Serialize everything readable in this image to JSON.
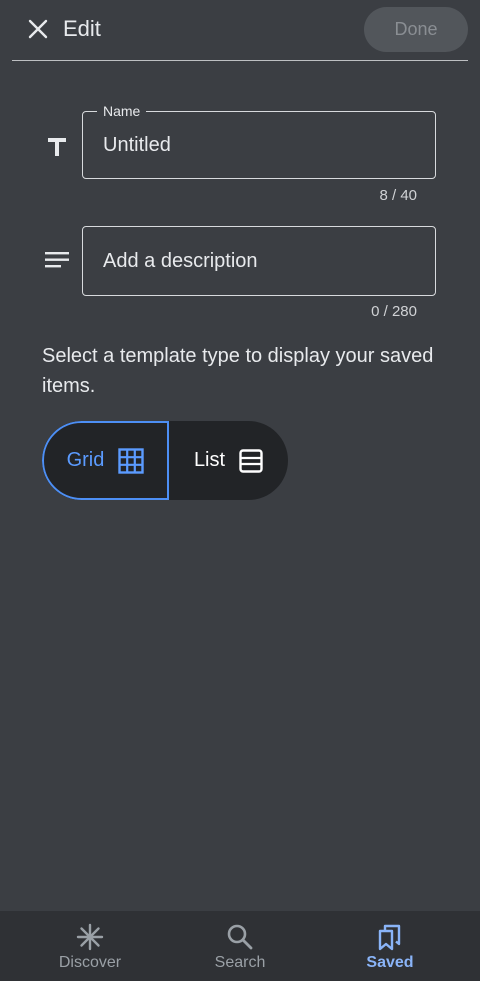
{
  "header": {
    "title": "Edit",
    "done_label": "Done"
  },
  "name_field": {
    "legend": "Name",
    "value": "Untitled",
    "counter": "8 / 40"
  },
  "description_field": {
    "placeholder": "Add a description",
    "value": "",
    "counter": "0 / 280"
  },
  "template": {
    "instruction": "Select a template type to display your saved items.",
    "options": [
      {
        "label": "Grid",
        "selected": true
      },
      {
        "label": "List",
        "selected": false
      }
    ]
  },
  "bottom_nav": {
    "items": [
      {
        "label": "Discover",
        "icon": "asterisk-icon",
        "active": false
      },
      {
        "label": "Search",
        "icon": "search-icon",
        "active": false
      },
      {
        "label": "Saved",
        "icon": "bookmarks-icon",
        "active": true
      }
    ]
  },
  "colors": {
    "background": "#3b3e43",
    "accent": "#4d8ff5",
    "nav_active": "#8ab4f8"
  }
}
